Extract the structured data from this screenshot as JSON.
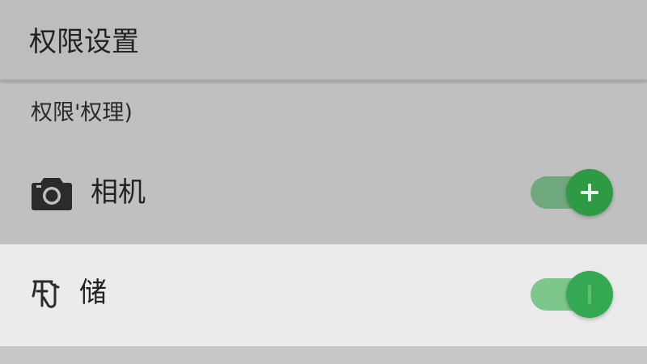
{
  "header": {
    "title": "权限设置"
  },
  "section": {
    "title": "权限'权理)"
  },
  "permissions": [
    {
      "label": "相机",
      "icon": "camera-icon",
      "enabled": true,
      "knob_icon": "plus-icon"
    },
    {
      "label": "储",
      "icon": "storage-icon",
      "enabled": true,
      "knob_icon": "bar-icon"
    }
  ],
  "colors": {
    "header_bg": "#bdbdbd",
    "page_bg": "#c0c0c0",
    "highlight_row_bg": "#ebebeb",
    "toggle_on": "#34a853",
    "toggle_track": "#7dc78c"
  }
}
